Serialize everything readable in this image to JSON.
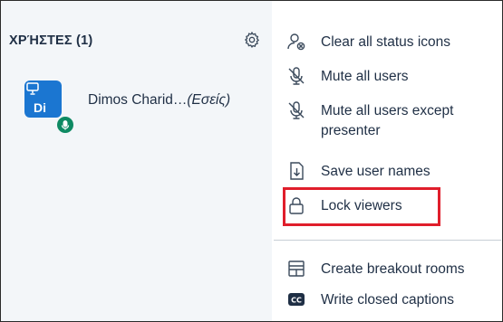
{
  "users_panel": {
    "header": "ΧΡΉΣΤΕΣ (1)",
    "settings_icon": "gear-icon",
    "users": [
      {
        "initials": "Di",
        "name": "Dimos Charid…",
        "you_label": "(Εσείς)",
        "avatar_color": "#1b76d1",
        "presenter_icon": "presentation-icon",
        "mic_badge_color": "#0e8a63",
        "mic_icon": "microphone-icon"
      }
    ]
  },
  "menu": {
    "items": [
      {
        "label": "Clear all status icons",
        "icon": "clear-status-icon"
      },
      {
        "label": "Mute all users",
        "icon": "mute-icon"
      },
      {
        "label": "Mute all users except presenter",
        "icon": "mute-icon"
      },
      {
        "label": "Save user names",
        "icon": "download-icon"
      },
      {
        "label": "Lock viewers",
        "icon": "lock-icon",
        "highlighted": true
      },
      {
        "label": "Create breakout rooms",
        "icon": "rooms-icon"
      },
      {
        "label": "Write closed captions",
        "icon": "closed-captions-icon"
      }
    ]
  },
  "colors": {
    "panel_bg": "#f3f6f9",
    "text": "#1f2f45",
    "highlight_border": "#e01e2b"
  }
}
